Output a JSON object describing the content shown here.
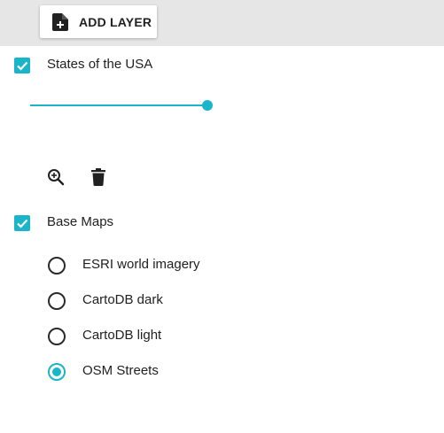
{
  "toolbar": {
    "add_layer_label": "ADD LAYER",
    "add_layer_icon": "add-file-icon"
  },
  "layers": [
    {
      "name": "States of the USA",
      "checked": true,
      "opacity_percent": 100,
      "actions": [
        "zoom-in-icon",
        "trash-icon"
      ]
    }
  ],
  "base_maps": {
    "title": "Base Maps",
    "checked": true,
    "options": [
      {
        "label": "ESRI world imagery",
        "selected": false
      },
      {
        "label": "CartoDB dark",
        "selected": false
      },
      {
        "label": "CartoDB light",
        "selected": false
      },
      {
        "label": "OSM Streets",
        "selected": true
      }
    ]
  },
  "colors": {
    "accent": "#1ab5c9",
    "toolbar_bg": "#e6e6e6",
    "text": "#212121"
  }
}
